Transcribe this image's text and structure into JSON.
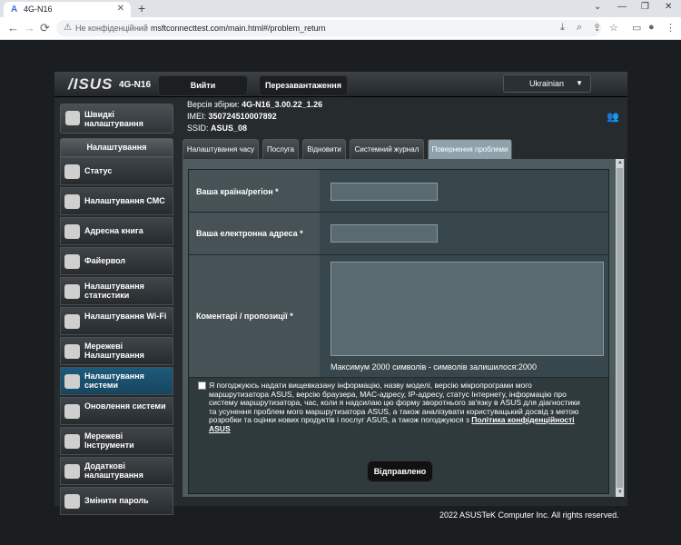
{
  "browser": {
    "tab_title": "4G-N16",
    "tab_logo": "A",
    "new_tab": "+",
    "window_controls": [
      "⌄",
      "—",
      "❐",
      "✕"
    ],
    "back": "←",
    "forward": "→",
    "reload": "⟳",
    "not_secure": "Не конфіденційний",
    "url": "msftconnecttest.com/main.html#/problem_return",
    "toolbar_icons": [
      "download-icon",
      "search-icon",
      "share-icon",
      "star-icon",
      "sidebar-icon",
      "profile-icon",
      "menu-icon"
    ]
  },
  "router": {
    "brand": "/ISUS",
    "model": "4G-N16",
    "logout_label": "Вийти",
    "reboot_label": "Перезавантаження",
    "language": "Ukrainian",
    "firmware_label": "Версія збірки:",
    "firmware_value": "4G-N16_3.00.22_1.26",
    "imei_label": "IMEI:",
    "imei_value": "350724510007892",
    "ssid_label": "SSID:",
    "ssid_value": "ASUS_08",
    "quick_setup": "Швидкі налаштування",
    "menu_header": "Налаштування",
    "menu": [
      {
        "label": "Статус",
        "icon": "status-icon"
      },
      {
        "label": "Налаштування СМС",
        "icon": "sms-icon"
      },
      {
        "label": "Адресна книга",
        "icon": "address-book-icon"
      },
      {
        "label": "Файервол",
        "icon": "firewall-icon"
      },
      {
        "label": "Налаштування статистики",
        "icon": "statistics-icon"
      },
      {
        "label": "Налаштування Wi-Fi",
        "icon": "wifi-icon"
      },
      {
        "label": "Мережеві Налаштування",
        "icon": "network-icon"
      },
      {
        "label": "Налаштування системи",
        "icon": "system-icon"
      },
      {
        "label": "Оновлення системи",
        "icon": "update-icon"
      },
      {
        "label": "Мережеві Інструменти",
        "icon": "tools-icon"
      },
      {
        "label": "Додаткові налаштування",
        "icon": "advanced-icon"
      },
      {
        "label": "Змінити пароль",
        "icon": "password-icon"
      }
    ],
    "tabs": [
      "Налаштування часу",
      "Послуга",
      "Відновити",
      "Системний журнал",
      "Повернення проблеми"
    ],
    "form": {
      "country_label": "Ваша країна/регіон *",
      "email_label": "Ваша електронна адреса *",
      "comments_label": "Коментарі / пропозиції *",
      "country_value": "",
      "email_value": "",
      "comments_value": "",
      "max_chars_text": "Максимум 2000 символів - символів залишилося:2000",
      "consent_text": "Я погоджуюсь надати вищевказану інформацію, назву моделі, версію мікропрограми мого маршрутизатора ASUS, версію браузера, MAC-адресу, IP-адресу, статус Інтернету, інформацію про систему маршрутизатора, час, коли я надсилаю цю форму зворотнього зв'язку в ASUS для діагностики та усунення проблем мого маршрутизатора ASUS, а також аналізувати користувацький досвід з метою розробки та оцінки нових продуктів і послуг ASUS, а також погоджуюся з",
      "privacy_link": "Політика конфіденційності ASUS",
      "submit_label": "Відправлено"
    },
    "footer": "2022 ASUSTeK Computer Inc. All rights reserved."
  }
}
